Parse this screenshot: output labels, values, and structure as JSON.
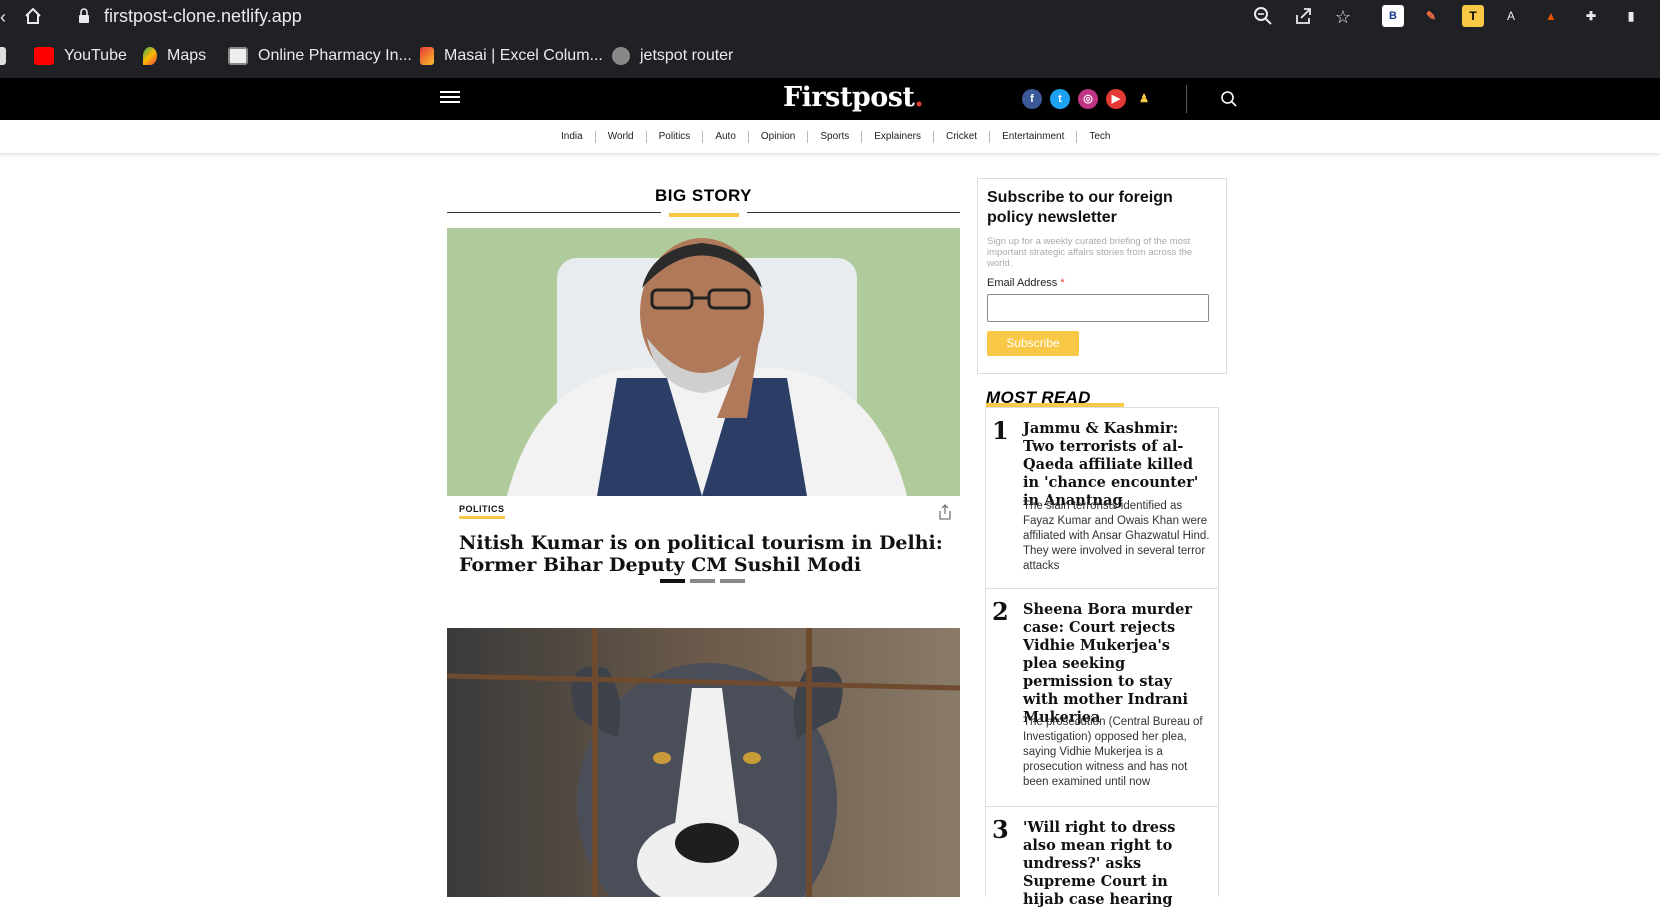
{
  "browser": {
    "url": "firstpost-clone.netlify.app",
    "bookmarks": [
      {
        "label": "YouTube"
      },
      {
        "label": "Maps"
      },
      {
        "label": "Online Pharmacy In..."
      },
      {
        "label": "Masai | Excel Colum..."
      },
      {
        "label": "jetspot router"
      }
    ]
  },
  "site": {
    "logo": "Firstpost",
    "logo_dot": ".",
    "nav": [
      "India",
      "World",
      "Politics",
      "Auto",
      "Opinion",
      "Sports",
      "Explainers",
      "Cricket",
      "Entertainment",
      "Tech"
    ]
  },
  "big_story": {
    "section_title": "BIG STORY",
    "category": "POLITICS",
    "headline": "Nitish Kumar is on political tourism in Delhi: Former Bihar Deputy CM Sushil Modi"
  },
  "newsletter": {
    "title": "Subscribe to our foreign policy newsletter",
    "description": "Sign up for a weekly curated briefing of the most important strategic affairs stories from across the world.",
    "email_label": "Email Address",
    "required_mark": "*",
    "button": "Subscribe"
  },
  "most_read": {
    "title": "MOST READ",
    "items": [
      {
        "num": "1",
        "headline": "Jammu & Kashmir: Two terrorists of al-Qaeda affiliate killed in 'chance encounter' in Anantnag",
        "desc": "The slain terrorists identified as Fayaz Kumar and Owais Khan were affiliated with Ansar Ghazwatul Hind. They were involved in several terror attacks"
      },
      {
        "num": "2",
        "headline": "Sheena Bora murder case: Court rejects Vidhie Mukerjea's plea seeking permission to stay with mother Indrani Mukerjea",
        "desc": "The prosecution (Central Bureau of Investigation) opposed her plea, saying Vidhie Mukerjea is a prosecution witness and has not been examined until now"
      },
      {
        "num": "3",
        "headline": "'Will right to dress also mean right to undress?' asks Supreme Court in hijab case hearing",
        "desc": ""
      }
    ]
  },
  "colors": {
    "accent": "#f9c846",
    "header_bg": "#000000",
    "chrome_bg": "#202124"
  }
}
